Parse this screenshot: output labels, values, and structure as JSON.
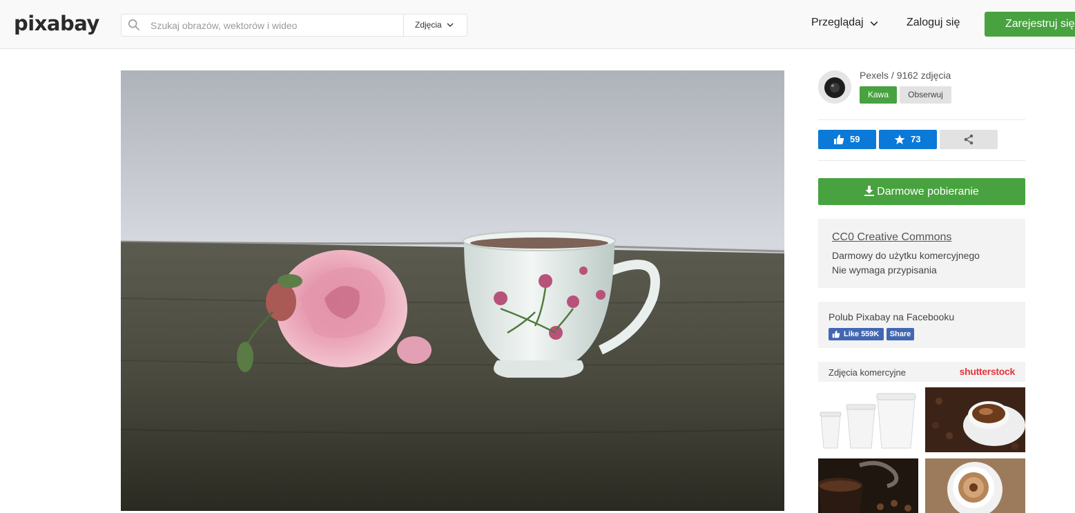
{
  "header": {
    "logo": "pixabay",
    "search": {
      "placeholder": "Szukaj obrazów, wektorów i wideo",
      "type": "Zdjęcia"
    },
    "nav": {
      "browse": "Przeglądaj",
      "login": "Zaloguj się",
      "register": "Zarejestruj się"
    }
  },
  "author": {
    "name": "Pexels / 9162 zdjęcia",
    "coffee_label": "Kawa",
    "follow_label": "Obserwuj"
  },
  "stats": {
    "likes": "59",
    "favorites": "73"
  },
  "download_label": "Darmowe pobieranie",
  "license": {
    "title": "CC0 Creative Commons",
    "line1": "Darmowy do użytku komercyjnego",
    "line2": "Nie wymaga przypisania"
  },
  "facebook": {
    "text": "Polub Pixabay na Facebooku",
    "like_label": "Like 559K",
    "share_label": "Share"
  },
  "sponsored": {
    "title": "Zdjęcia komercyjne",
    "brand": "shutterstock"
  },
  "colors": {
    "green": "#48a23f",
    "blue": "#0078d7",
    "facebook": "#4267b2",
    "shutterstock": "#e2353a"
  }
}
